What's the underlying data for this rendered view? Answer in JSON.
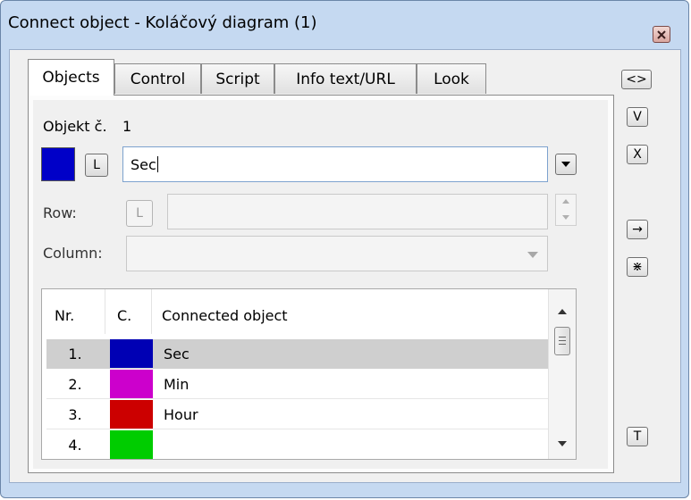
{
  "window": {
    "title": "Connect object - Koláčový diagram (1)"
  },
  "tabs": [
    {
      "label": "Objects",
      "active": true
    },
    {
      "label": "Control",
      "active": false
    },
    {
      "label": "Script",
      "active": false
    },
    {
      "label": "Info text/URL",
      "active": false
    },
    {
      "label": "Look",
      "active": false
    }
  ],
  "objects_tab": {
    "object_number_label": "Objekt č.",
    "object_number_value": "1",
    "object_color": "#0000c8",
    "l_button": "L",
    "object_name_value": "Sec",
    "row_label": "Row:",
    "row_value": "",
    "column_label": "Column:",
    "column_value": ""
  },
  "grid": {
    "columns": [
      "Nr.",
      "C.",
      "Connected object"
    ],
    "rows": [
      {
        "nr": "1.",
        "color": "#0000b4",
        "name": "Sec",
        "selected": true
      },
      {
        "nr": "2.",
        "color": "#cc00cc",
        "name": "Min",
        "selected": false
      },
      {
        "nr": "3.",
        "color": "#cc0000",
        "name": "Hour",
        "selected": false
      },
      {
        "nr": "4.",
        "color": "#00cc00",
        "name": "",
        "selected": false
      }
    ]
  },
  "side_buttons": {
    "swap": "<>",
    "confirm": "V",
    "cancel": "X",
    "apply_arrow": "→",
    "split": "⋇",
    "text": "T"
  }
}
